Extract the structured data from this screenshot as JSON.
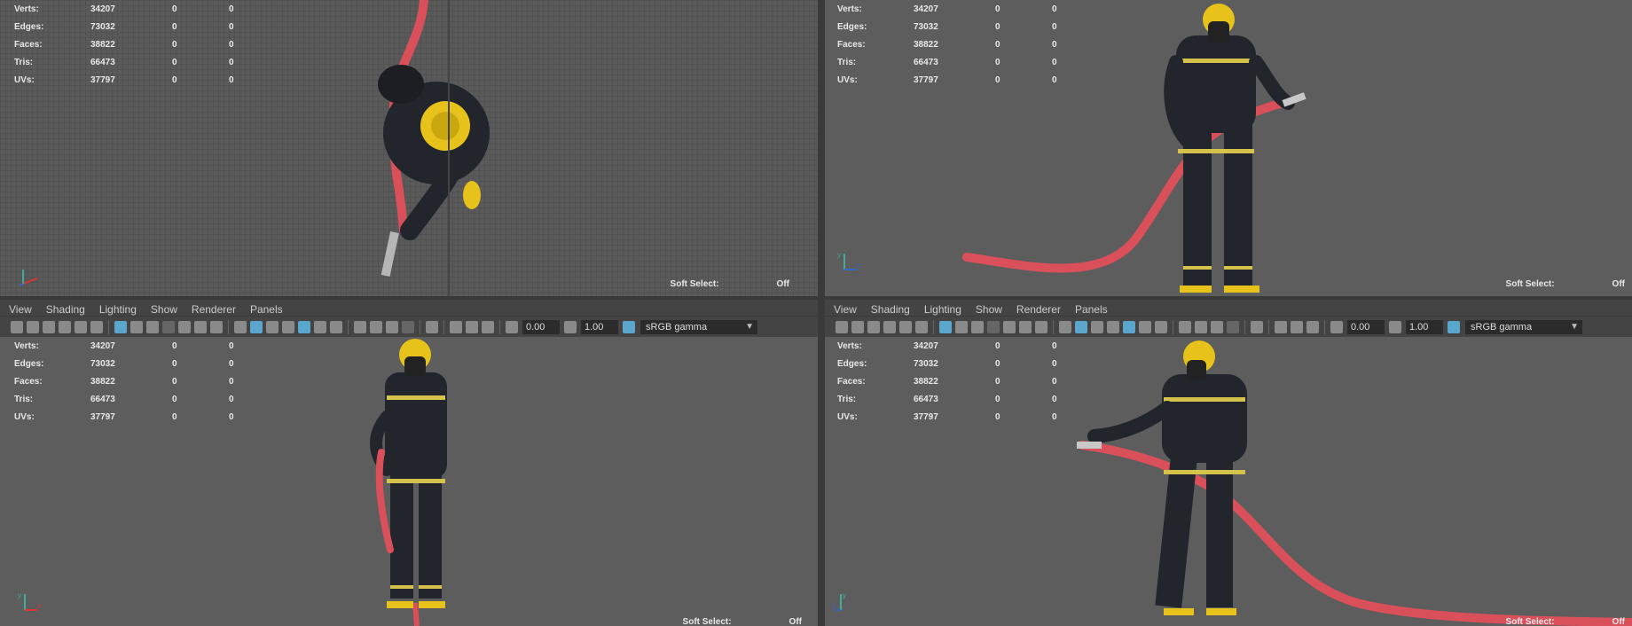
{
  "stats": {
    "rows": [
      {
        "label": "Verts:",
        "v1": "34207",
        "v2": "0",
        "v3": "0"
      },
      {
        "label": "Edges:",
        "v1": "73032",
        "v2": "0",
        "v3": "0"
      },
      {
        "label": "Faces:",
        "v1": "38822",
        "v2": "0",
        "v3": "0"
      },
      {
        "label": "Tris:",
        "v1": "66473",
        "v2": "0",
        "v3": "0"
      },
      {
        "label": "UVs:",
        "v1": "37797",
        "v2": "0",
        "v3": "0"
      }
    ]
  },
  "soft_select": {
    "label": "Soft Select:",
    "value": "Off"
  },
  "menu": {
    "items": [
      "View",
      "Shading",
      "Lighting",
      "Show",
      "Renderer",
      "Panels"
    ]
  },
  "toolbar": {
    "exposure": "0.00",
    "gamma_value": "1.00",
    "color_space": "sRGB gamma"
  },
  "axis": {
    "x": "x",
    "y": "y",
    "z": "z"
  },
  "colors": {
    "hose": "#d9505a",
    "helmet": "#e6c21a",
    "suit": "#22252c",
    "stripe": "#d4c24a",
    "viewport": "#5d5d5d"
  },
  "viewports": [
    "top",
    "persp",
    "front",
    "side"
  ]
}
